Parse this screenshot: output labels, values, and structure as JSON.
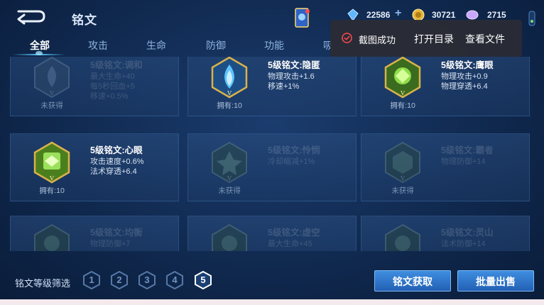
{
  "header": {
    "title": "铭文",
    "resources": [
      {
        "name": "diamond",
        "value": "22586",
        "color": "#5fb7ff"
      },
      {
        "name": "gold",
        "value": "30721",
        "color": "#e7b43a"
      },
      {
        "name": "crystal",
        "value": "2715",
        "color": "#c9a6ff"
      }
    ],
    "plus_label": "+"
  },
  "tabs": [
    {
      "label": "全部",
      "active": true
    },
    {
      "label": "攻击",
      "active": false
    },
    {
      "label": "生命",
      "active": false
    },
    {
      "label": "防御",
      "active": false
    },
    {
      "label": "功能",
      "active": false
    },
    {
      "label": "吸",
      "active": false
    }
  ],
  "runes": [
    {
      "name": "5级铭文:调和",
      "attrs": [
        "最大生命+40",
        "每5秒回血+5",
        "移速+0.5%"
      ],
      "status": "未获得",
      "owned": false,
      "color": "#8aa5c2"
    },
    {
      "name": "5级铭文:隐匿",
      "attrs": [
        "物理攻击+1.6",
        "移速+1%"
      ],
      "status": "拥有:10",
      "owned": true,
      "color": "#3aa5e8"
    },
    {
      "name": "5级铭文:鹰眼",
      "attrs": [
        "物理攻击+0.9",
        "物理穿透+6.4"
      ],
      "status": "拥有:10",
      "owned": true,
      "color": "#5fb33a"
    },
    {
      "name": "5级铭文:心眼",
      "attrs": [
        "攻击速度+0.6%",
        "法术穿透+6.4"
      ],
      "status": "拥有:10",
      "owned": true,
      "color": "#7bc23a"
    },
    {
      "name": "5级铭文:怜悯",
      "attrs": [
        "冷却缩减+1%"
      ],
      "status": "未获得",
      "owned": false,
      "color": "#6f8faf"
    },
    {
      "name": "5级铭文:霸者",
      "attrs": [
        "物理防御+14"
      ],
      "status": "未获得",
      "owned": false,
      "color": "#6f8faf"
    },
    {
      "name": "5级铭文:均衡",
      "attrs": [
        "物理防御+7"
      ],
      "status": "",
      "owned": false,
      "color": "#6f8faf"
    },
    {
      "name": "5级铭文:虚空",
      "attrs": [
        "最大生命+45"
      ],
      "status": "",
      "owned": false,
      "color": "#6f8faf"
    },
    {
      "name": "5级铭文:灵山",
      "attrs": [
        "法术防御+14"
      ],
      "status": "",
      "owned": false,
      "color": "#6f8faf"
    }
  ],
  "filter": {
    "label": "铭文等级筛选",
    "levels": [
      "1",
      "2",
      "3",
      "4",
      "5"
    ],
    "selected": "5"
  },
  "buttons": {
    "acquire": "铭文获取",
    "sell": "批量出售"
  },
  "toast": {
    "message": "截图成功",
    "open_dir": "打开目录",
    "view_file": "查看文件"
  }
}
